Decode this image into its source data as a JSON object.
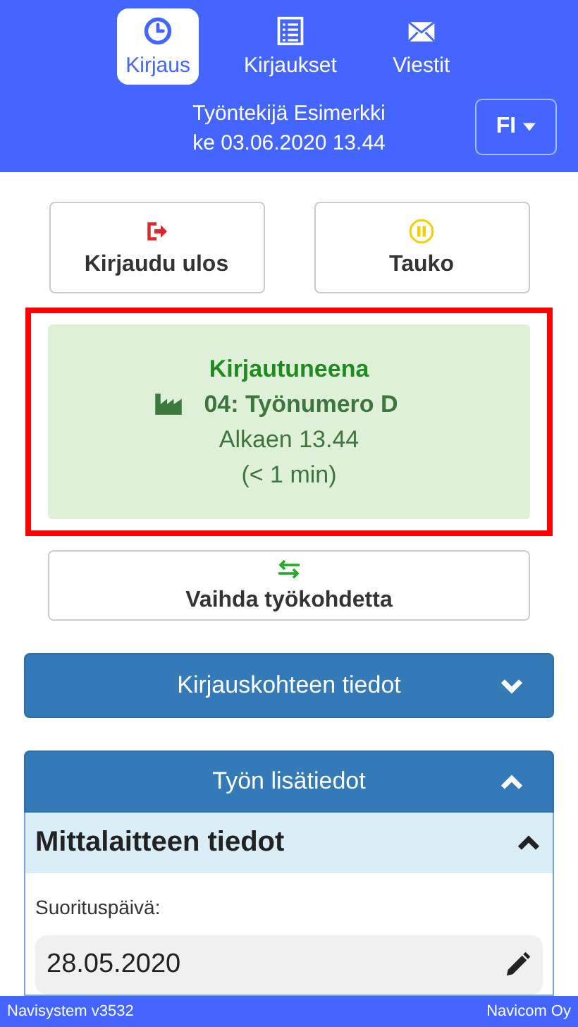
{
  "tabs": [
    {
      "label": "Kirjaus",
      "kind": "clock",
      "selected": true
    },
    {
      "label": "Kirjaukset",
      "kind": "list",
      "selected": false
    },
    {
      "label": "Viestit",
      "kind": "envelope",
      "selected": false
    }
  ],
  "user": {
    "name": "Työntekijä Esimerkki",
    "datetime": "ke 03.06.2020 13.44"
  },
  "language": {
    "label": "FI"
  },
  "actions": [
    {
      "label": "Kirjaudu ulos",
      "kind": "logout"
    },
    {
      "label": "Tauko",
      "kind": "pause"
    }
  ],
  "status": {
    "title": "Kirjautuneena",
    "job": "04: Työnumero D",
    "since": "Alkaen 13.44",
    "duration": "(< 1 min)",
    "highlighted": true
  },
  "switch_button": {
    "label": "Vaihda työkohdetta"
  },
  "panels": [
    {
      "title": "Kirjauskohteen tiedot",
      "expanded": false
    },
    {
      "title": "Työn lisätiedot",
      "expanded": true,
      "sections": [
        {
          "title": "Mittalaitteen tiedot",
          "expanded": true,
          "fields": [
            {
              "label": "Suorituspäivä:",
              "value": "28.05.2020"
            }
          ]
        }
      ]
    }
  ],
  "footer": {
    "left": "Navisystem v3532",
    "right": "Navicom Oy"
  }
}
